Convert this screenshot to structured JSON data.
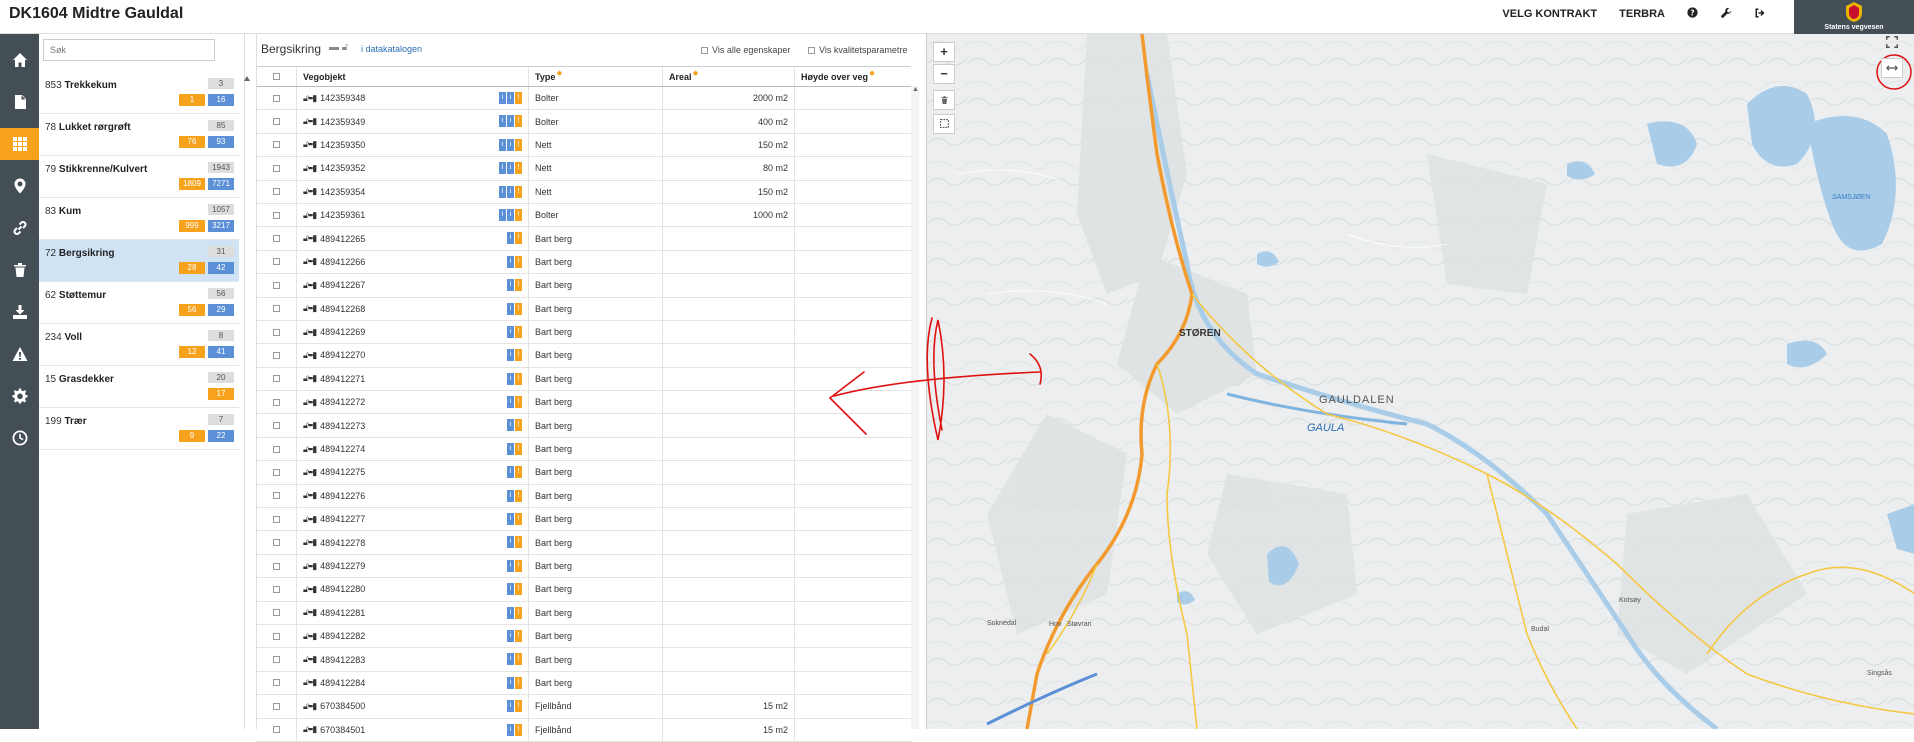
{
  "header": {
    "title": "DK1604 Midtre Gauldal",
    "nav": [
      {
        "label": "VELG KONTRAKT"
      },
      {
        "label": "TERBRA"
      }
    ],
    "brand_name": "Statens vegvesen"
  },
  "leftnav": {
    "items": [
      {
        "icon": "home-icon"
      },
      {
        "icon": "document-icon"
      },
      {
        "icon": "grid-icon",
        "active": true
      },
      {
        "icon": "map-pin-icon"
      },
      {
        "icon": "link-icon"
      },
      {
        "icon": "trash-icon"
      },
      {
        "icon": "download-icon"
      },
      {
        "icon": "warning-icon"
      },
      {
        "icon": "settings-icon"
      },
      {
        "icon": "history-icon"
      }
    ]
  },
  "catalog": {
    "search_placeholder": "Søk",
    "items": [
      {
        "id": "853",
        "name": "Trekkekum",
        "total": "3",
        "orange": "1",
        "blue": "16"
      },
      {
        "id": "78",
        "name": "Lukket rørgrøft",
        "total": "85",
        "orange": "76",
        "blue": "93"
      },
      {
        "id": "79",
        "name": "Stikkrenne/Kulvert",
        "total": "1943",
        "orange": "1809",
        "blue": "7271"
      },
      {
        "id": "83",
        "name": "Kum",
        "total": "1057",
        "orange": "999",
        "blue": "3217"
      },
      {
        "id": "72",
        "name": "Bergsikring",
        "total": "31",
        "orange": "28",
        "blue": "42",
        "selected": true
      },
      {
        "id": "62",
        "name": "Støttemur",
        "total": "56",
        "orange": "56",
        "blue": "29"
      },
      {
        "id": "234",
        "name": "Voll",
        "total": "8",
        "orange": "12",
        "blue": "41"
      },
      {
        "id": "15",
        "name": "Grasdekker",
        "total": "20",
        "orange": "17",
        "blue": ""
      },
      {
        "id": "199",
        "name": "Trær",
        "total": "7",
        "orange": "9",
        "blue": "22"
      }
    ]
  },
  "table": {
    "title": "Bergsikring",
    "catalog_link": "i datakatalogen",
    "opt_all_props": "Vis alle egenskaper",
    "opt_quality": "Vis kvalitetsparametre",
    "columns": {
      "obj": "Vegobjekt",
      "type": "Type",
      "areal": "Areal",
      "hoyde": "Høyde over veg"
    },
    "rows": [
      {
        "id": "142359348",
        "type": "Bolter",
        "areal": "2000 m2",
        "badges": "bbo"
      },
      {
        "id": "142359349",
        "type": "Bolter",
        "areal": "400 m2",
        "badges": "bbo"
      },
      {
        "id": "142359350",
        "type": "Nett",
        "areal": "150 m2",
        "badges": "bbo"
      },
      {
        "id": "142359352",
        "type": "Nett",
        "areal": "80 m2",
        "badges": "bbo"
      },
      {
        "id": "142359354",
        "type": "Nett",
        "areal": "150 m2",
        "badges": "bbo"
      },
      {
        "id": "142359361",
        "type": "Bolter",
        "areal": "1000 m2",
        "badges": "bbo"
      },
      {
        "id": "489412265",
        "type": "Bart berg",
        "areal": "",
        "badges": "bo"
      },
      {
        "id": "489412266",
        "type": "Bart berg",
        "areal": "",
        "badges": "bo"
      },
      {
        "id": "489412267",
        "type": "Bart berg",
        "areal": "",
        "badges": "bo"
      },
      {
        "id": "489412268",
        "type": "Bart berg",
        "areal": "",
        "badges": "bo"
      },
      {
        "id": "489412269",
        "type": "Bart berg",
        "areal": "",
        "badges": "bo"
      },
      {
        "id": "489412270",
        "type": "Bart berg",
        "areal": "",
        "badges": "bo"
      },
      {
        "id": "489412271",
        "type": "Bart berg",
        "areal": "",
        "badges": "bo"
      },
      {
        "id": "489412272",
        "type": "Bart berg",
        "areal": "",
        "badges": "bo"
      },
      {
        "id": "489412273",
        "type": "Bart berg",
        "areal": "",
        "badges": "bo"
      },
      {
        "id": "489412274",
        "type": "Bart berg",
        "areal": "",
        "badges": "bo"
      },
      {
        "id": "489412275",
        "type": "Bart berg",
        "areal": "",
        "badges": "bo"
      },
      {
        "id": "489412276",
        "type": "Bart berg",
        "areal": "",
        "badges": "bo"
      },
      {
        "id": "489412277",
        "type": "Bart berg",
        "areal": "",
        "badges": "bo"
      },
      {
        "id": "489412278",
        "type": "Bart berg",
        "areal": "",
        "badges": "bo"
      },
      {
        "id": "489412279",
        "type": "Bart berg",
        "areal": "",
        "badges": "bo"
      },
      {
        "id": "489412280",
        "type": "Bart berg",
        "areal": "",
        "badges": "bo"
      },
      {
        "id": "489412281",
        "type": "Bart berg",
        "areal": "",
        "badges": "bo"
      },
      {
        "id": "489412282",
        "type": "Bart berg",
        "areal": "",
        "badges": "bo"
      },
      {
        "id": "489412283",
        "type": "Bart berg",
        "areal": "",
        "badges": "bo"
      },
      {
        "id": "489412284",
        "type": "Bart berg",
        "areal": "",
        "badges": "bo"
      },
      {
        "id": "670384500",
        "type": "Fjellbånd",
        "areal": "15 m2",
        "badges": "bo"
      },
      {
        "id": "670384501",
        "type": "Fjellbånd",
        "areal": "15 m2",
        "badges": "bo"
      }
    ]
  },
  "map": {
    "zoom_in": "+",
    "zoom_out": "−",
    "labels": {
      "storen": "STØREN",
      "gauldalen": "GAULDALEN",
      "gaula": "GAULA",
      "soknedal": "Soknedal",
      "hov": "Hov",
      "storvann": "Støvran",
      "samsjoen": "SAMSJØEN",
      "singsas": "Singsås",
      "kotsoy": "Kotsøy",
      "budal": "Budal"
    },
    "road_color": "#f39a2e",
    "water_color": "#a9cde9",
    "annotation_color": "#e01010"
  }
}
